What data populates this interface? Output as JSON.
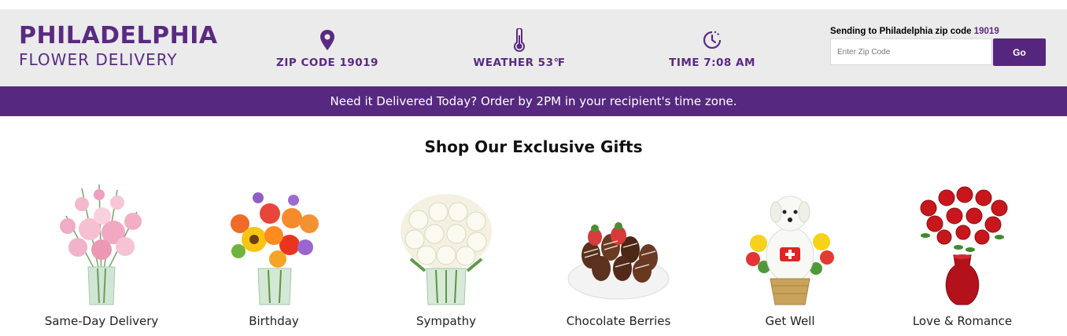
{
  "brand": {
    "title": "PHILADELPHIA",
    "subtitle": "FLOWER DELIVERY"
  },
  "info": {
    "zip": "ZIP CODE 19019",
    "weather": "WEATHER 53℉",
    "time": "TIME 7:08 AM"
  },
  "zip_widget": {
    "prefix": "Sending to Philadelphia zip code",
    "code": "19019",
    "placeholder": "Enter Zip Code",
    "button": "Go"
  },
  "banner": "Need it Delivered Today? Order by 2PM in your recipient's time zone.",
  "shop_title": "Shop Our Exclusive Gifts",
  "products": [
    {
      "name": "Same-Day Delivery",
      "icon": "pink-lily-bouquet"
    },
    {
      "name": "Birthday",
      "icon": "sunflower-bouquet"
    },
    {
      "name": "Sympathy",
      "icon": "white-rose-bouquet"
    },
    {
      "name": "Chocolate Berries",
      "icon": "chocolate-strawberries"
    },
    {
      "name": "Get Well",
      "icon": "puppy-flower-basket"
    },
    {
      "name": "Love & Romance",
      "icon": "red-rose-vase"
    }
  ],
  "colors": {
    "brand": "#5a2a82",
    "banner": "#56287f",
    "header_bg": "#ebebeb"
  }
}
